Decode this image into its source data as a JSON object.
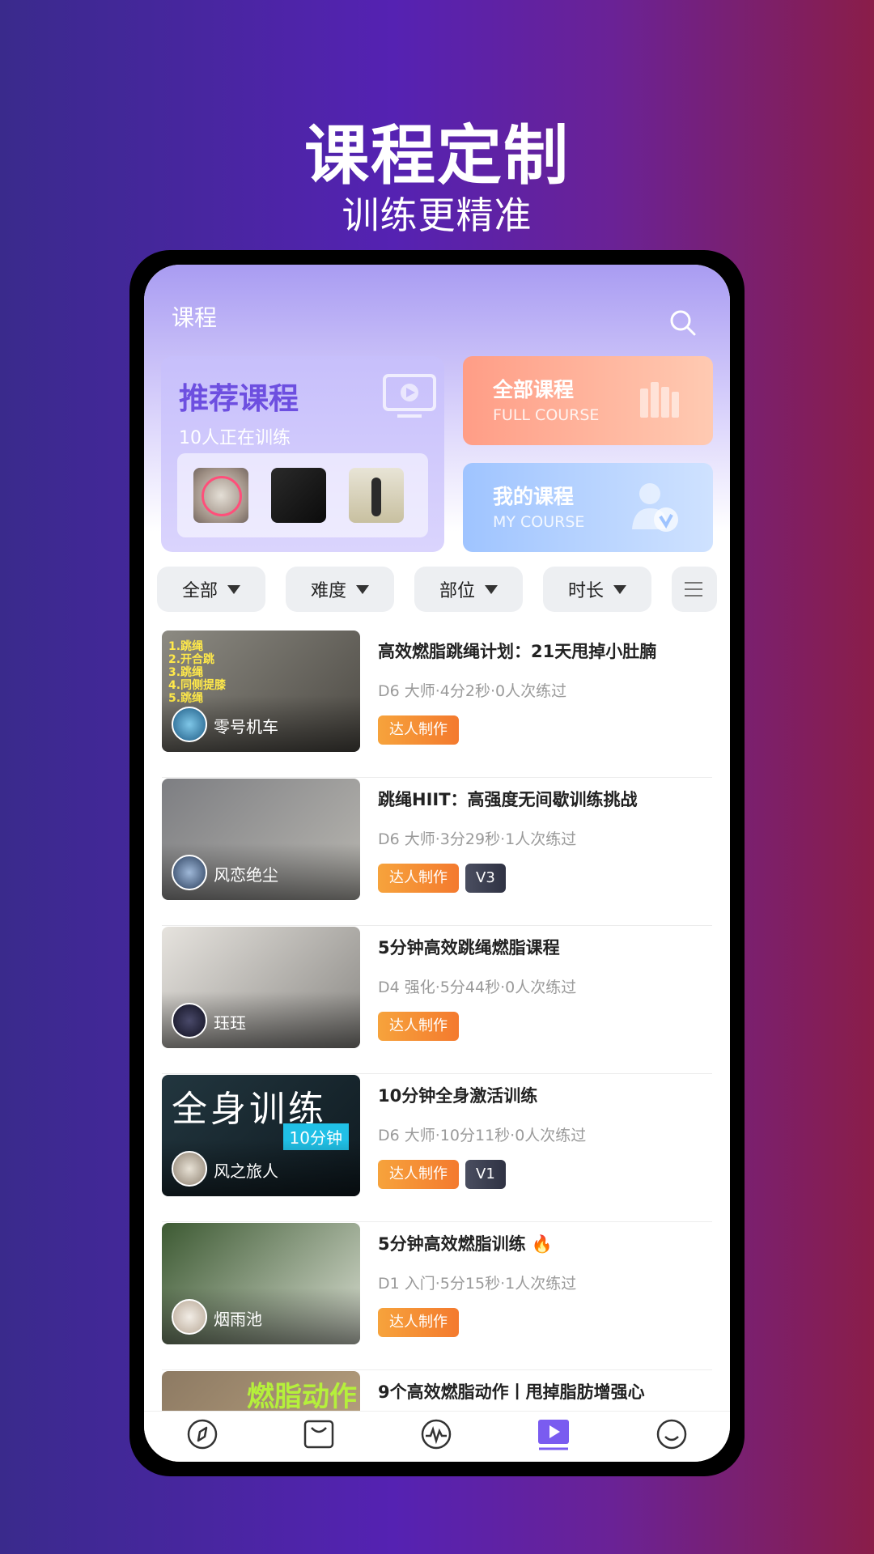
{
  "hero": {
    "title": "课程定制",
    "subtitle": "训练更精准"
  },
  "header": {
    "title": "课程"
  },
  "recommend": {
    "title": "推荐课程",
    "subtitle": "10人正在训练"
  },
  "all_course": {
    "title": "全部课程",
    "subtitle": "FULL COURSE"
  },
  "my_course": {
    "title": "我的课程",
    "subtitle": "MY COURSE"
  },
  "filters": [
    "全部",
    "难度",
    "部位",
    "时长"
  ],
  "courses": [
    {
      "title": "高效燃脂跳绳计划：21天甩掉小肚腩",
      "meta": "D6 大师·4分2秒·0人次练过",
      "author": "零号机车",
      "badges": [
        "达人制作"
      ]
    },
    {
      "title": "跳绳HIIT：高强度无间歇训练挑战",
      "meta": "D6 大师·3分29秒·1人次练过",
      "author": "风恋绝尘",
      "badges": [
        "达人制作",
        "V3"
      ]
    },
    {
      "title": "5分钟高效跳绳燃脂课程",
      "meta": "D4 强化·5分44秒·0人次练过",
      "author": "珏珏",
      "badges": [
        "达人制作"
      ]
    },
    {
      "title": "10分钟全身激活训练",
      "meta": "D6 大师·10分11秒·0人次练过",
      "author": "风之旅人",
      "badges": [
        "达人制作",
        "V1"
      ]
    },
    {
      "title": "5分钟高效燃脂训练 🔥",
      "meta": "D1 入门·5分15秒·1人次练过",
      "author": "烟雨池",
      "badges": [
        "达人制作"
      ]
    },
    {
      "title": "9个高效燃脂动作丨甩掉脂肪增强心",
      "meta": "",
      "author": "",
      "badges": []
    }
  ],
  "thumb_overlays": {
    "jump": "1.跳绳\n2.开合跳\n3.跳绳\n4.同侧提膝\n5.跳绳",
    "full_body": "全身训练",
    "ten_min": "10分钟",
    "burn": "燃脂动作"
  },
  "tabs": [
    "compass-icon",
    "inbox-icon",
    "activity-icon",
    "play-icon",
    "smile-icon"
  ],
  "colors": {
    "accent": "#6d4fe0",
    "badge": "#f47a2e"
  }
}
